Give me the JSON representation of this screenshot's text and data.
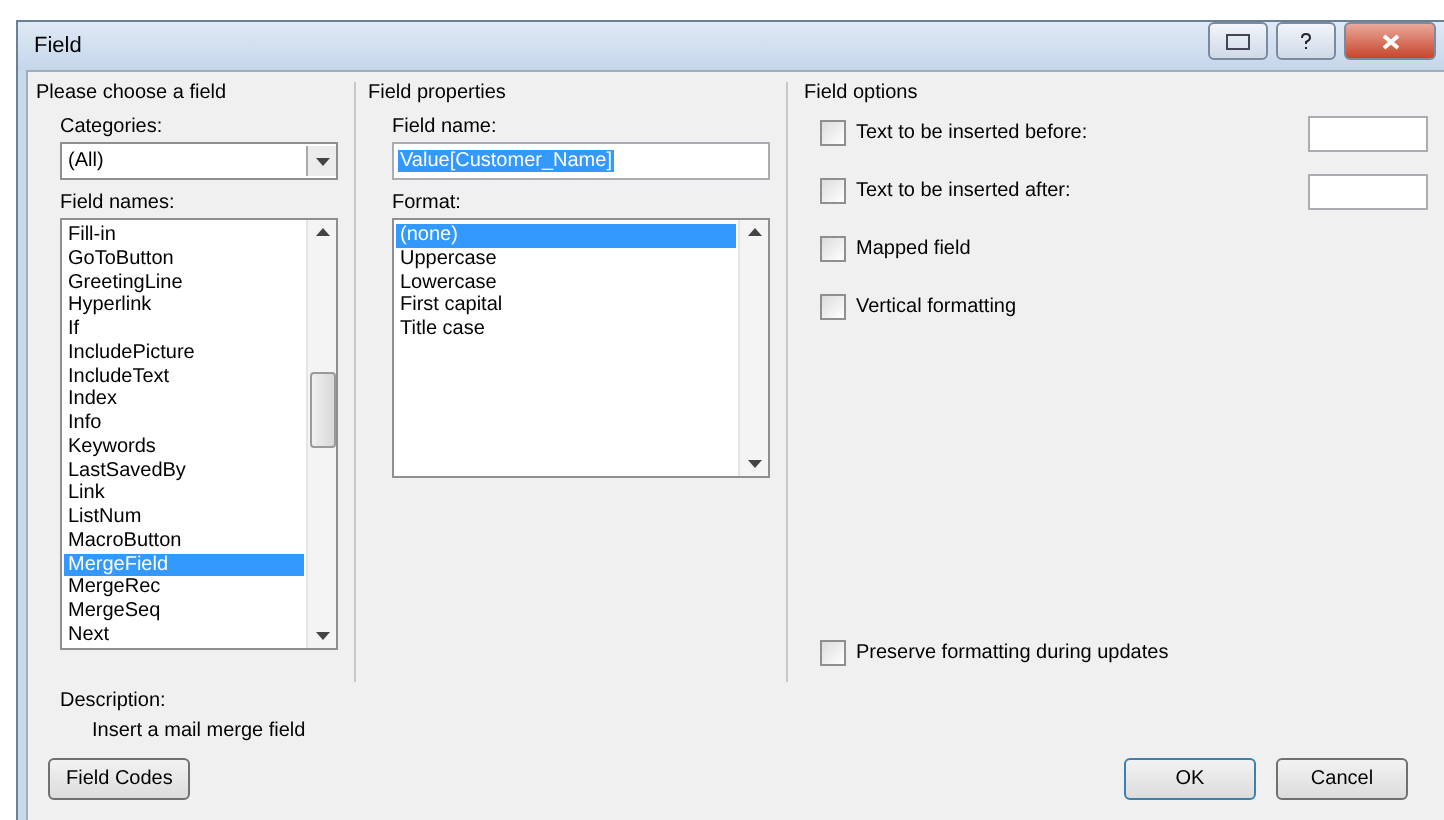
{
  "window": {
    "title": "Field"
  },
  "choose": {
    "title": "Please choose a field",
    "categories_label": "Categories:",
    "categories_value": "(All)",
    "names_label": "Field names:",
    "names": [
      {
        "label": "Fill-in",
        "selected": false
      },
      {
        "label": "GoToButton",
        "selected": false
      },
      {
        "label": "GreetingLine",
        "selected": false
      },
      {
        "label": "Hyperlink",
        "selected": false
      },
      {
        "label": "If",
        "selected": false
      },
      {
        "label": "IncludePicture",
        "selected": false
      },
      {
        "label": "IncludeText",
        "selected": false
      },
      {
        "label": "Index",
        "selected": false
      },
      {
        "label": "Info",
        "selected": false
      },
      {
        "label": "Keywords",
        "selected": false
      },
      {
        "label": "LastSavedBy",
        "selected": false
      },
      {
        "label": "Link",
        "selected": false
      },
      {
        "label": "ListNum",
        "selected": false
      },
      {
        "label": "MacroButton",
        "selected": false
      },
      {
        "label": "MergeField",
        "selected": true
      },
      {
        "label": "MergeRec",
        "selected": false
      },
      {
        "label": "MergeSeq",
        "selected": false
      },
      {
        "label": "Next",
        "selected": false
      }
    ]
  },
  "properties": {
    "title": "Field properties",
    "name_label": "Field name:",
    "name_value": "Value[Customer_Name]",
    "format_label": "Format:",
    "formats": [
      {
        "label": "(none)",
        "selected": true
      },
      {
        "label": "Uppercase",
        "selected": false
      },
      {
        "label": "Lowercase",
        "selected": false
      },
      {
        "label": "First capital",
        "selected": false
      },
      {
        "label": "Title case",
        "selected": false
      }
    ]
  },
  "options": {
    "title": "Field options",
    "items": [
      {
        "kind": "text",
        "label": "Text to be inserted before:",
        "checked": false
      },
      {
        "kind": "text",
        "label": "Text to be inserted after:",
        "checked": false
      },
      {
        "kind": "plain",
        "label": "Mapped field",
        "checked": false
      },
      {
        "kind": "plain",
        "label": "Vertical formatting",
        "checked": false
      }
    ],
    "preserve": {
      "label": "Preserve formatting during updates",
      "checked": false
    }
  },
  "description": {
    "label": "Description:",
    "text": "Insert a mail merge field"
  },
  "buttons": {
    "left": "Field Codes",
    "ok": "OK",
    "cancel": "Cancel"
  }
}
